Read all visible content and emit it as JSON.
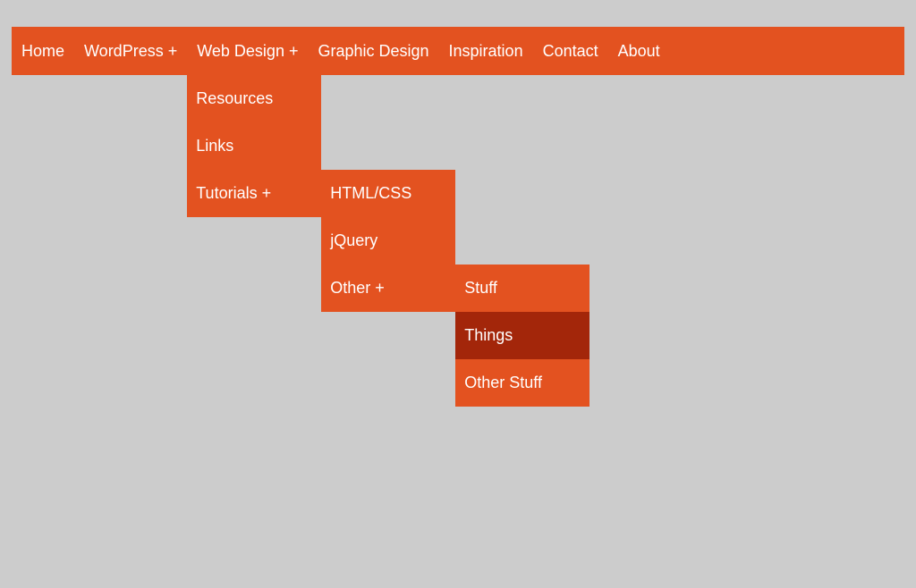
{
  "submenu_suffix": "+",
  "nav": {
    "items": [
      {
        "label": "Home"
      },
      {
        "label": "WordPress",
        "has_sub": true
      },
      {
        "label": "Web Design",
        "has_sub": true
      },
      {
        "label": "Graphic Design"
      },
      {
        "label": "Inspiration"
      },
      {
        "label": "Contact"
      },
      {
        "label": "About"
      }
    ]
  },
  "web_design_submenu": {
    "items": [
      {
        "label": "Resources"
      },
      {
        "label": "Links"
      },
      {
        "label": "Tutorials",
        "has_sub": true
      }
    ]
  },
  "tutorials_submenu": {
    "items": [
      {
        "label": "HTML/CSS"
      },
      {
        "label": "jQuery"
      },
      {
        "label": "Other",
        "has_sub": true
      }
    ]
  },
  "other_submenu": {
    "items": [
      {
        "label": "Stuff"
      },
      {
        "label": "Things",
        "hovered": true
      },
      {
        "label": "Other Stuff"
      }
    ]
  }
}
